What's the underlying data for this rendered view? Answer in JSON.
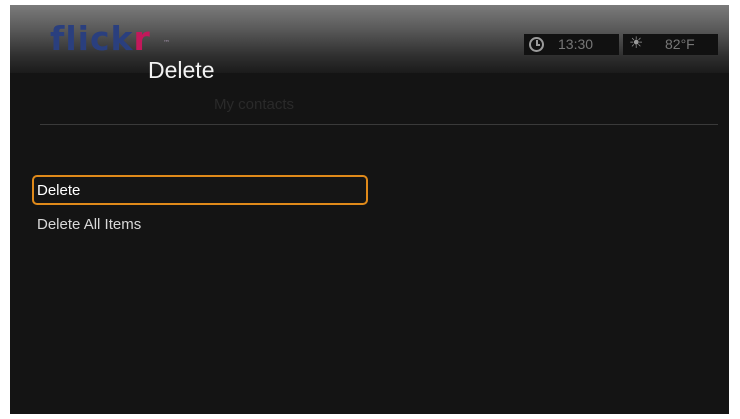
{
  "app": {
    "logo_main": "flick",
    "logo_accent": "r",
    "logo_tm": "™"
  },
  "overlay": {
    "title": "Delete",
    "context": "My contacts"
  },
  "status": {
    "time": "13:30",
    "temperature": "82°F",
    "clock_icon": "clock-icon",
    "weather_icon": "sun-icon"
  },
  "menu": {
    "items": [
      {
        "label": "Delete",
        "selected": true
      },
      {
        "label": "Delete All Items",
        "selected": false
      }
    ]
  },
  "colors": {
    "selection_border": "#e08a1a",
    "logo_blue": "#2a3f7e",
    "logo_pink": "#c2185b"
  }
}
